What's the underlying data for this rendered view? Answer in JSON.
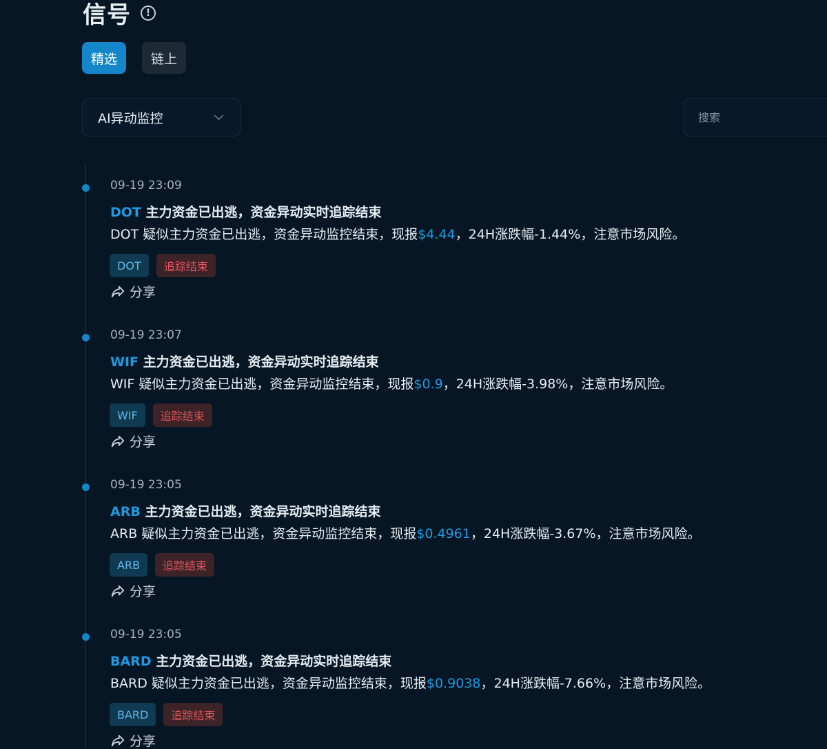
{
  "header": {
    "title": "信号"
  },
  "tabs": [
    {
      "label": "精选",
      "active": true
    },
    {
      "label": "链上",
      "active": false
    }
  ],
  "filter": {
    "selected": "AI异动监控"
  },
  "search": {
    "placeholder": "搜索"
  },
  "share_label": "分享",
  "entries": [
    {
      "time": "09-19 23:09",
      "symbol": "DOT",
      "headline": " 主力资金已出逃，资金异动实时追踪结束",
      "desc_prefix": "DOT 疑似主力资金已出逃，资金异动监控结束，现报",
      "price": "$4.44",
      "desc_suffix": "，24H涨跌幅-1.44%，注意市场风险。",
      "tag_coin": "DOT",
      "tag_status": "追踪结束"
    },
    {
      "time": "09-19 23:07",
      "symbol": "WIF",
      "headline": " 主力资金已出逃，资金异动实时追踪结束",
      "desc_prefix": "WIF 疑似主力资金已出逃，资金异动监控结束，现报",
      "price": "$0.9",
      "desc_suffix": "，24H涨跌幅-3.98%，注意市场风险。",
      "tag_coin": "WIF",
      "tag_status": "追踪结束"
    },
    {
      "time": "09-19 23:05",
      "symbol": "ARB",
      "headline": " 主力资金已出逃，资金异动实时追踪结束",
      "desc_prefix": "ARB 疑似主力资金已出逃，资金异动监控结束，现报",
      "price": "$0.4961",
      "desc_suffix": "，24H涨跌幅-3.67%，注意市场风险。",
      "tag_coin": "ARB",
      "tag_status": "追踪结束"
    },
    {
      "time": "09-19 23:05",
      "symbol": "BARD",
      "headline": " 主力资金已出逃，资金异动实时追踪结束",
      "desc_prefix": "BARD 疑似主力资金已出逃，资金异动监控结束，现报",
      "price": "$0.9038",
      "desc_suffix": "，24H涨跌幅-7.66%，注意市场风险。",
      "tag_coin": "BARD",
      "tag_status": "追踪结束"
    }
  ],
  "colors": {
    "background": "#061624",
    "accent": "#1486c9",
    "symbol": "#1e9be0",
    "status_tag_text": "#e2555a"
  },
  "icons": {
    "info": "info-circle-icon",
    "chevron": "chevron-down-icon",
    "share": "share-arrow-icon"
  }
}
